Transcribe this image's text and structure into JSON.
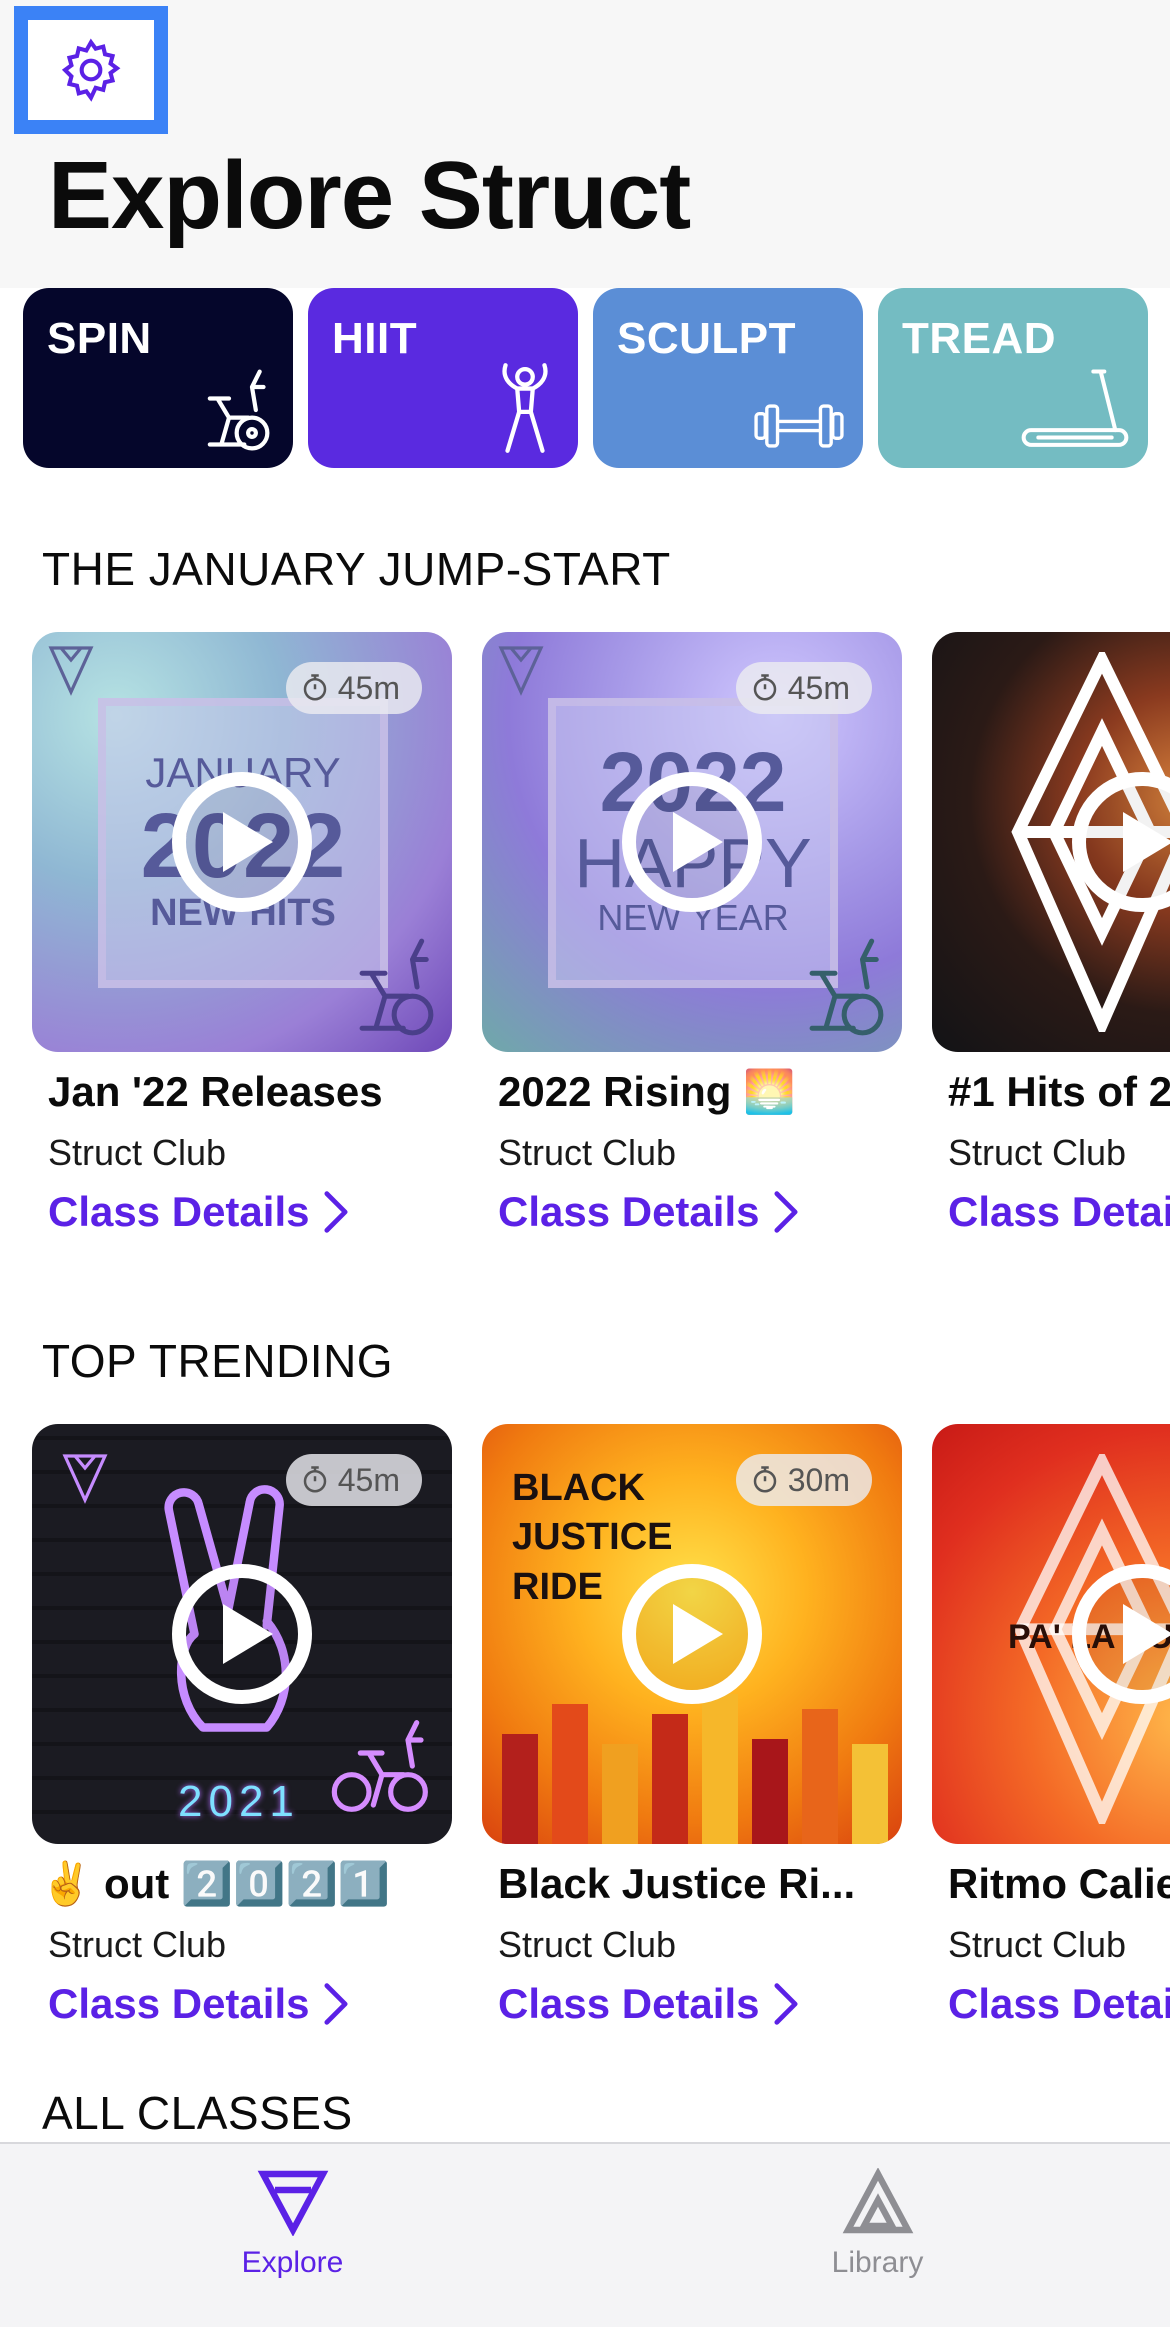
{
  "header": {
    "title": "Explore Struct",
    "settings_icon": "gear-icon"
  },
  "categories": [
    {
      "label": "SPIN",
      "color": "#05062b",
      "icon": "bike-icon"
    },
    {
      "label": "HIIT",
      "color": "#5a2ae0",
      "icon": "jumping-person-icon"
    },
    {
      "label": "SCULPT",
      "color": "#5b8ed6",
      "icon": "dumbbell-icon"
    },
    {
      "label": "TREAD",
      "color": "#74bcc2",
      "icon": "treadmill-icon"
    }
  ],
  "sections": [
    {
      "title": "THE JANUARY JUMP-START",
      "cards": [
        {
          "duration": "45m",
          "art_lines": [
            "JANUARY",
            "2022",
            "NEW HITS"
          ],
          "title": "Jan '22 Releases",
          "subtitle": "Struct Club",
          "link": "Class Details"
        },
        {
          "duration": "45m",
          "art_lines": [
            "2022",
            "HAPPY",
            "NEW YEAR"
          ],
          "title": "2022 Rising 🌅",
          "subtitle": "Struct Club",
          "link": "Class Details"
        },
        {
          "duration": "",
          "title": "#1 Hits of 2",
          "subtitle": "Struct Club",
          "link": "Class Detai"
        }
      ]
    },
    {
      "title": "TOP TRENDING",
      "cards": [
        {
          "duration": "45m",
          "art_lines": [
            "2021"
          ],
          "title": "✌️ out 2️⃣0️⃣2️⃣1️⃣",
          "subtitle": "Struct Club",
          "link": "Class Details"
        },
        {
          "duration": "30m",
          "art_lines": [
            "BLACK",
            "JUSTICE",
            "RIDE"
          ],
          "title": "Black Justice Ri...",
          "subtitle": "Struct Club",
          "link": "Class Details"
        },
        {
          "duration": "",
          "art_lines": [
            "PA' LA CU"
          ],
          "title": "Ritmo Calie",
          "subtitle": "Struct Club",
          "link": "Class Detai"
        }
      ]
    }
  ],
  "all_classes": {
    "title": "ALL CLASSES"
  },
  "tabbar": {
    "explore": {
      "label": "Explore",
      "color": "#5b21e6"
    },
    "library": {
      "label": "Library",
      "color": "#8e8e93"
    }
  }
}
